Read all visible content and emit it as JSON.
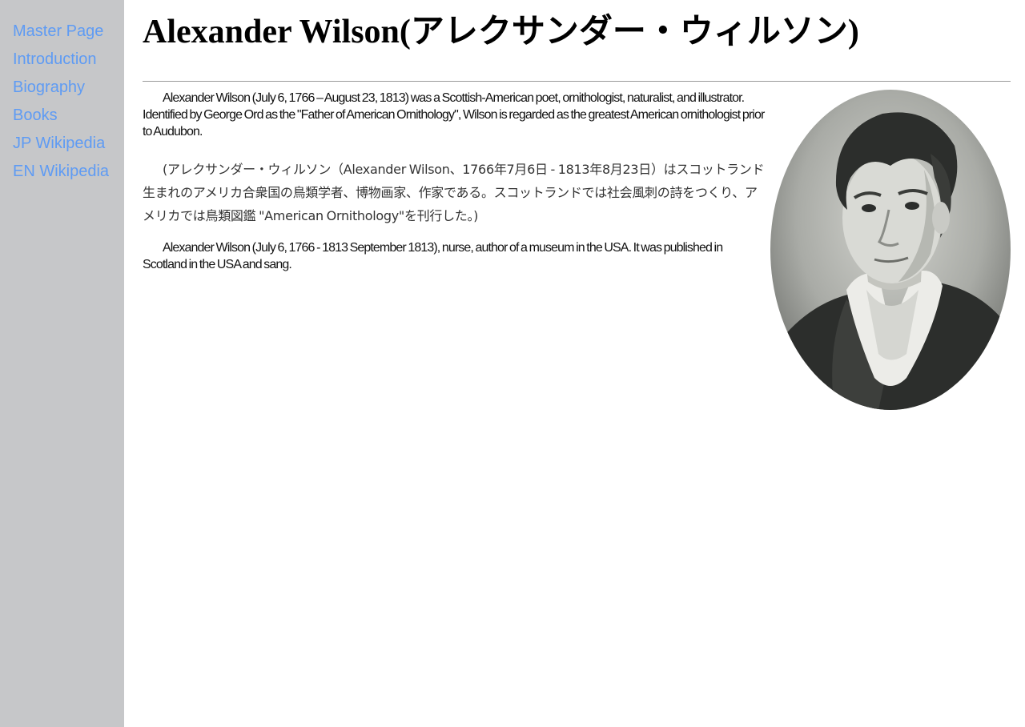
{
  "sidebar": {
    "items": [
      {
        "label": "Master Page"
      },
      {
        "label": "Introduction"
      },
      {
        "label": "Biography"
      },
      {
        "label": "Books"
      },
      {
        "label": "JP Wikipedia"
      },
      {
        "label": "EN Wikipedia"
      }
    ]
  },
  "main": {
    "title": "Alexander Wilson(アレクサンダー・ウィルソン)",
    "paragraphs": [
      "Alexander Wilson (July 6, 1766 – August 23, 1813) was a Scottish-American poet, ornithologist, naturalist, and illustrator. Identified by George Ord as the \"Father of American Ornithology\", Wilson is regarded as the greatest American ornithologist prior to Audubon.",
      "(アレクサンダー・ウィルソン（Alexander Wilson、1766年7月6日 - 1813年8月23日）はスコットランド生まれのアメリカ合衆国の鳥類学者、博物画家、作家である。スコットランドでは社会風刺の詩をつくり、アメリカでは鳥類図鑑 \"American Ornithology\"を刊行した。)",
      "Alexander Wilson (July 6, 1766 - 1813 September 1813), nurse, author of a museum in the USA. It was published in Scotland in the USA and sang."
    ],
    "portrait": {
      "icon": "portrait-engraving",
      "background": "#ffffff",
      "tone_light": "#d9dad5",
      "tone_dark": "#2c2e2c"
    }
  }
}
